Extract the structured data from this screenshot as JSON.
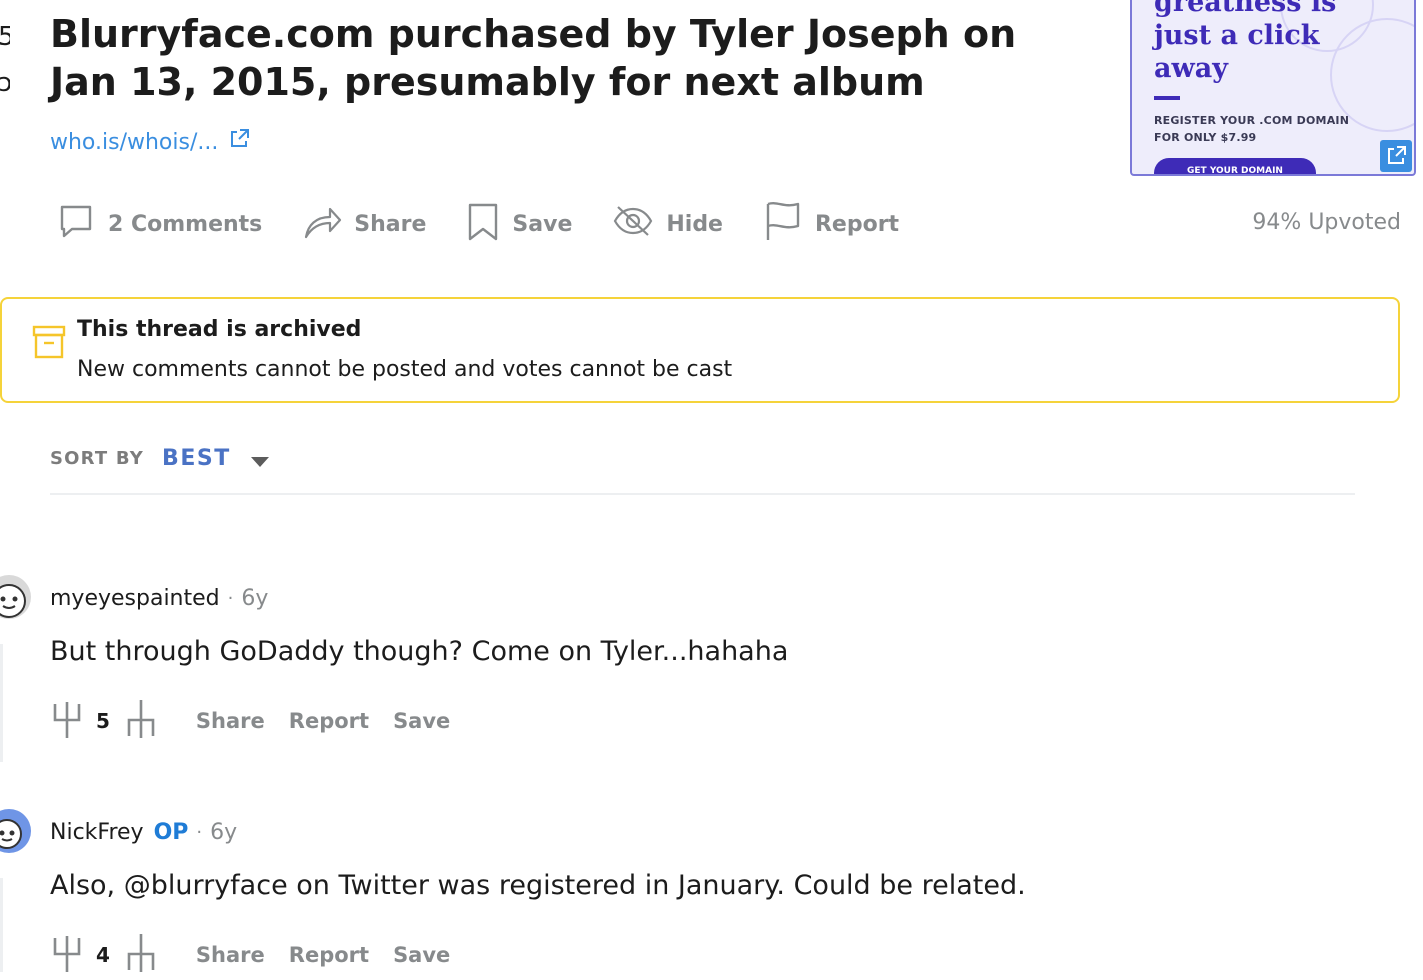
{
  "post": {
    "left_clip": "5\n",
    "title": "Blurryface.com purchased by Tyler Joseph on Jan 13, 2015, presumably for next album",
    "link_text": "who.is/whois/..."
  },
  "ad": {
    "headline": "greatness is just a click away",
    "subtext": "REGISTER YOUR .COM DOMAIN FOR ONLY $7.99",
    "button": "GET YOUR DOMAIN"
  },
  "actions": {
    "comments": "2 Comments",
    "share": "Share",
    "save": "Save",
    "hide": "Hide",
    "report": "Report",
    "upvoted": "94% Upvoted"
  },
  "archive": {
    "title": "This thread is archived",
    "message": "New comments cannot be posted and votes cannot be cast"
  },
  "sort": {
    "label": "SORT BY",
    "value": "BEST"
  },
  "comments": [
    {
      "author": "myeyespainted",
      "op": "",
      "age": "6y",
      "text": "But through GoDaddy though? Come on Tyler...hahaha",
      "votes": "5",
      "share": "Share",
      "report": "Report",
      "save": "Save"
    },
    {
      "author": "NickFrey",
      "op": "OP",
      "age": "6y",
      "text": "Also, @blurryface on Twitter was registered in January. Could be related.",
      "votes": "4",
      "share": "Share",
      "report": "Report",
      "save": "Save"
    }
  ],
  "colors": {
    "link": "#3a8ee0",
    "archive_border": "#f5d33a",
    "sort_value": "#4a72c4",
    "op_badge": "#1f7cd6",
    "ad_brand": "#3e2bb7"
  }
}
